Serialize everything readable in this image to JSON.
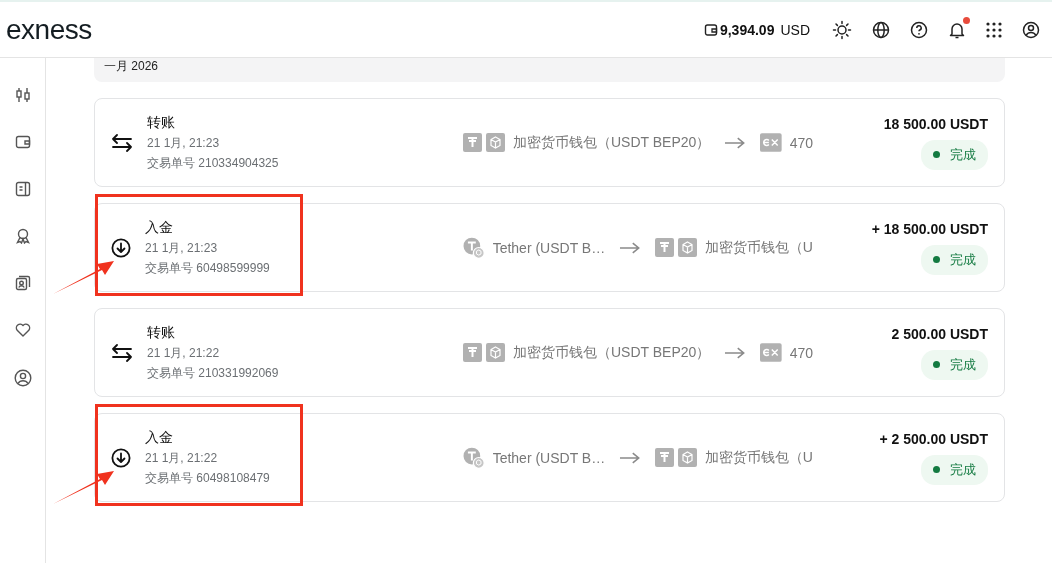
{
  "header": {
    "logo": "exness",
    "balance": {
      "amount": "9,394.09",
      "currency": "USD"
    },
    "notifications_unread": true
  },
  "month": "一月 2026",
  "transactions": [
    {
      "kind": "transfer",
      "title": "转账",
      "date": "21 1月, 21:23",
      "txid": "交易单号 210334904325",
      "from": {
        "kind": "pair",
        "text": "加密货币钱包（USDT BEP20）"
      },
      "to": {
        "kind": "broker",
        "text": "470"
      },
      "amount": "18 500.00 USDT",
      "status": {
        "label": "完成",
        "color": "#137a41"
      },
      "annotated": false
    },
    {
      "kind": "deposit",
      "title": "入金",
      "date": "21 1月, 21:23",
      "txid": "交易单号 60498599999",
      "from": {
        "kind": "coin",
        "text": "Tether (USDT B…"
      },
      "to": {
        "kind": "pair",
        "text": "加密货币钱包（U"
      },
      "amount": "+ 18 500.00 USDT",
      "status": {
        "label": "完成",
        "color": "#137a41"
      },
      "annotated": true
    },
    {
      "kind": "transfer",
      "title": "转账",
      "date": "21 1月, 21:22",
      "txid": "交易单号 210331992069",
      "from": {
        "kind": "pair",
        "text": "加密货币钱包（USDT BEP20）"
      },
      "to": {
        "kind": "broker",
        "text": "470"
      },
      "amount": "2 500.00 USDT",
      "status": {
        "label": "完成",
        "color": "#137a41"
      },
      "annotated": false
    },
    {
      "kind": "deposit",
      "title": "入金",
      "date": "21 1月, 21:22",
      "txid": "交易单号 60498108479",
      "from": {
        "kind": "coin",
        "text": "Tether (USDT B…"
      },
      "to": {
        "kind": "pair",
        "text": "加密货币钱包（U"
      },
      "amount": "+ 2 500.00 USDT",
      "status": {
        "label": "完成",
        "color": "#137a41"
      },
      "annotated": true
    }
  ]
}
